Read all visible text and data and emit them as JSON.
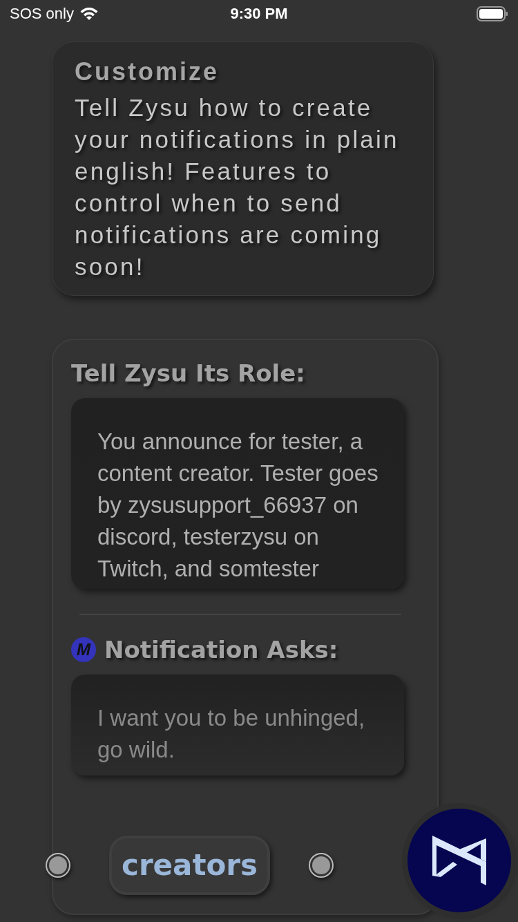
{
  "status_bar": {
    "carrier": "SOS only",
    "time": "9:30 PM"
  },
  "customize": {
    "title": "Customize",
    "text": "Tell Zysu how to create your notifications in plain english! Features to control when to send notifications are coming soon!"
  },
  "role": {
    "title": "Tell Zysu Its Role:",
    "text": "You announce for tester, a content creator. Tester goes by zysusupport_66937 on discord, testerzysu on Twitch, and somtester"
  },
  "asks": {
    "badge": "M",
    "title": "Notification Asks:",
    "text": "I want you to be unhinged, go wild."
  },
  "nav": [
    {
      "kind": "radio",
      "selected": false
    },
    {
      "kind": "tab",
      "label": "creators",
      "selected": true
    },
    {
      "kind": "radio",
      "selected": false
    }
  ]
}
